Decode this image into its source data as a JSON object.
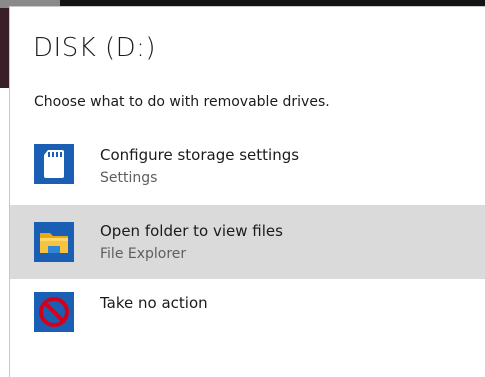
{
  "dialog": {
    "title": "DISK (D:)",
    "subtitle": "Choose what to do with removable drives."
  },
  "options": [
    {
      "title": "Configure storage settings",
      "subtitle": "Settings",
      "icon": "sd-card-icon",
      "highlighted": false
    },
    {
      "title": "Open folder to view files",
      "subtitle": "File Explorer",
      "icon": "folder-icon",
      "highlighted": true
    },
    {
      "title": "Take no action",
      "subtitle": "",
      "icon": "no-action-icon",
      "highlighted": false
    }
  ],
  "colors": {
    "icon_tile": "#1a5fb4",
    "highlight": "#dadada",
    "no_action_red": "#d0021b",
    "folder_yellow": "#f5c242"
  }
}
